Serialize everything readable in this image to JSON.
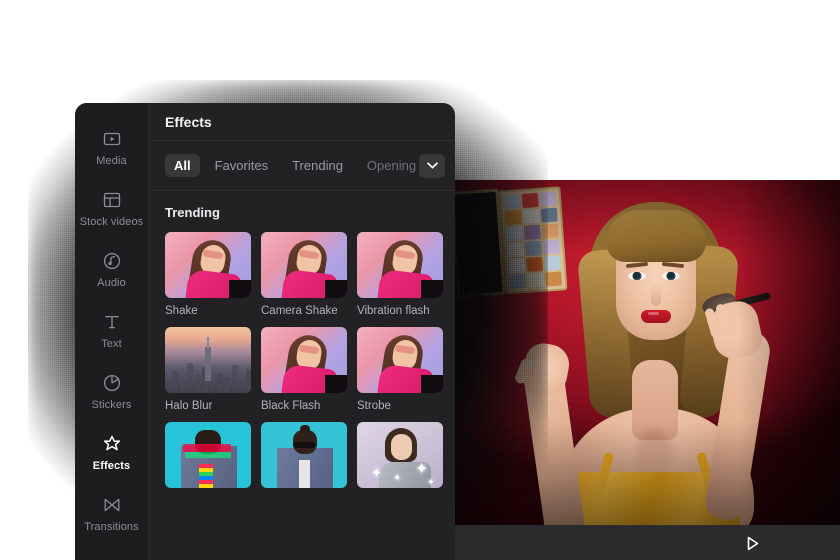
{
  "app": {
    "panel_title": "Effects"
  },
  "sidebar": {
    "items": [
      {
        "label": "Media",
        "icon": "media-icon",
        "active": false
      },
      {
        "label": "Stock videos",
        "icon": "stock-videos-icon",
        "active": false
      },
      {
        "label": "Audio",
        "icon": "audio-icon",
        "active": false
      },
      {
        "label": "Text",
        "icon": "text-icon",
        "active": false
      },
      {
        "label": "Stickers",
        "icon": "stickers-icon",
        "active": false
      },
      {
        "label": "Effects",
        "icon": "effects-icon",
        "active": true
      },
      {
        "label": "Transitions",
        "icon": "transitions-icon",
        "active": false
      }
    ]
  },
  "tabs": {
    "items": [
      {
        "label": "All",
        "active": true,
        "faded": false
      },
      {
        "label": "Favorites",
        "active": false,
        "faded": false
      },
      {
        "label": "Trending",
        "active": false,
        "faded": false
      },
      {
        "label": "Opening &",
        "active": false,
        "faded": true
      }
    ],
    "more_icon": "chevron-down-icon"
  },
  "effects": {
    "section_title": "Trending",
    "rows": [
      {
        "cells": [
          {
            "label": "Shake",
            "art": "girlpink"
          },
          {
            "label": "Camera Shake",
            "art": "girlpink"
          },
          {
            "label": "Vibration flash",
            "art": "girlpink"
          }
        ]
      },
      {
        "cells": [
          {
            "label": "Halo Blur",
            "art": "city"
          },
          {
            "label": "Black Flash",
            "art": "girlpink"
          },
          {
            "label": "Strobe",
            "art": "girlpink"
          }
        ]
      },
      {
        "cells": [
          {
            "label": "",
            "art": "glitch"
          },
          {
            "label": "",
            "art": "clean"
          },
          {
            "label": "",
            "art": "sparkle"
          }
        ]
      }
    ]
  },
  "preview": {
    "play_icon": "play-icon",
    "scene_description": "Woman holding eyeshadow palette and makeup brush on red backdrop"
  },
  "colors": {
    "panel_bg": "#222224",
    "sidebar_bg": "#1d1d1f",
    "accent_active": "#38383b",
    "text_primary": "#ffffff",
    "text_muted": "#8d8d92",
    "backdrop_red": "#b2162a",
    "top_yellow": "#e8a417",
    "page_bg": "#ffffff"
  },
  "palette_pans": [
    "#b9c3d6",
    "#d23b3b",
    "#c9b7dd",
    "#e09a2f",
    "#dcd6d0",
    "#6c7f99",
    "#cfd8e2",
    "#a27db0",
    "#e2a06a",
    "#e7e0d4",
    "#8fa6bd",
    "#c3b2d2",
    "#e8e2d8",
    "#e0661f",
    "#b9c9d8",
    "#9fb0c4",
    "#d9d2c6",
    "#c98a4a"
  ]
}
